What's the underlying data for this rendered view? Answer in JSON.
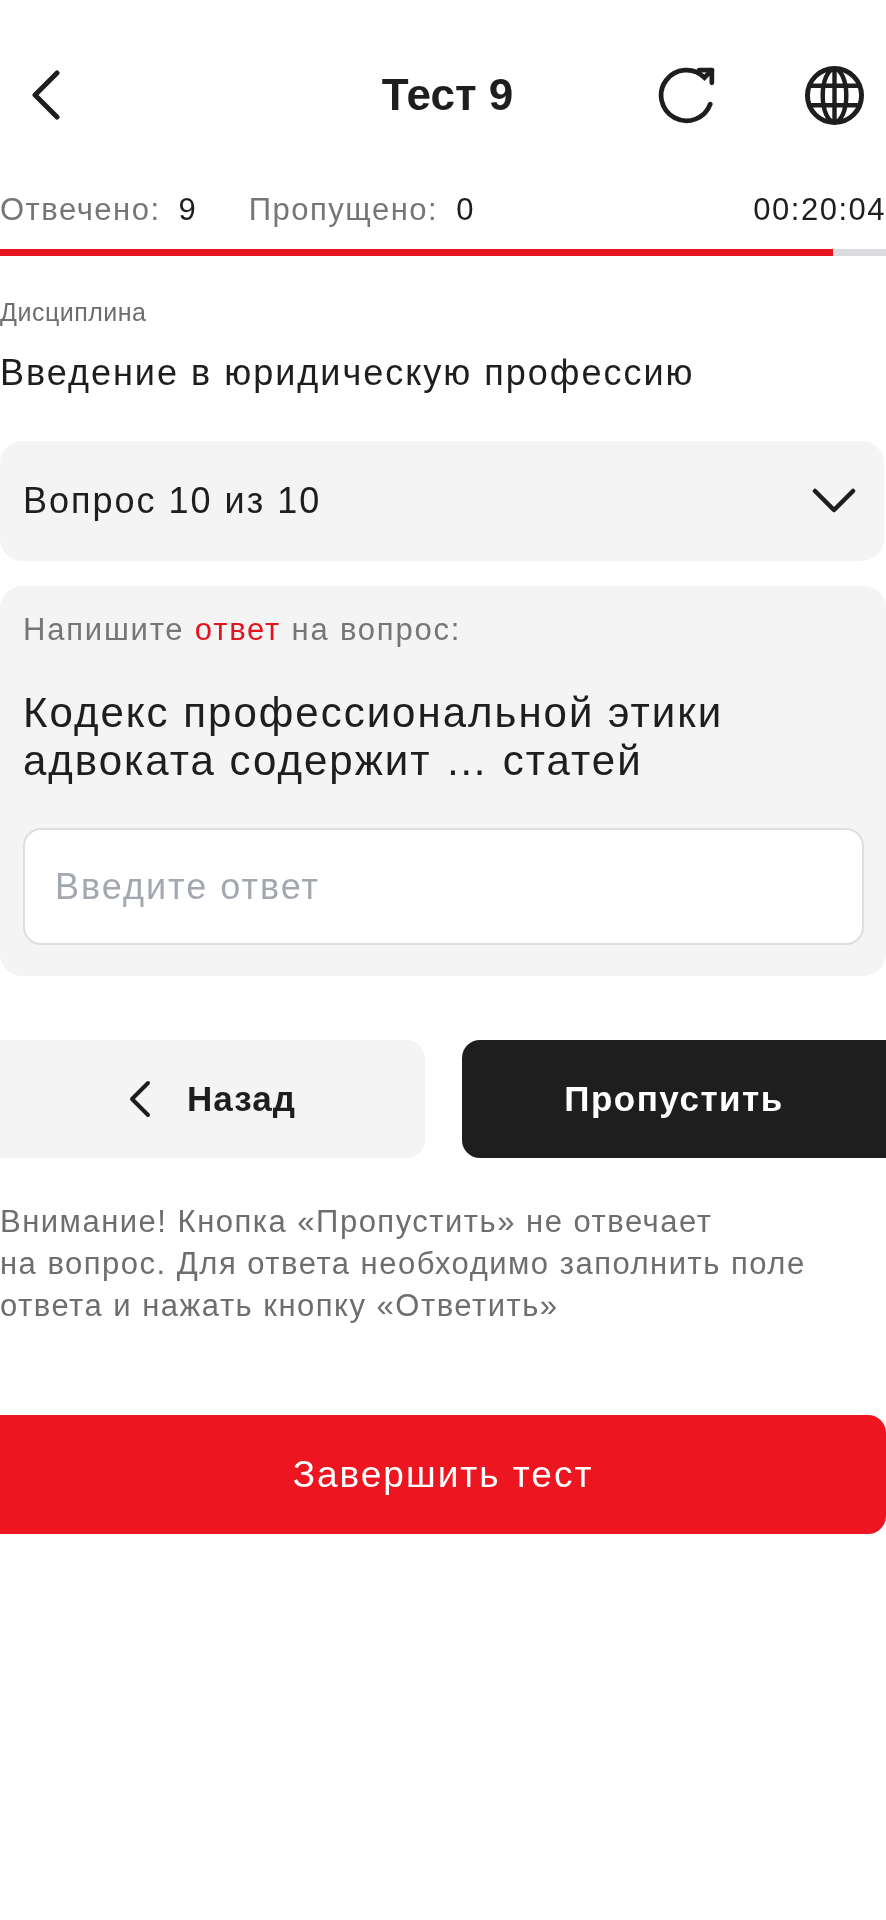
{
  "header": {
    "title": "Тест 9"
  },
  "stats": [
    {
      "label": "Отвечено:",
      "value": "9"
    },
    {
      "label": "Пропущено:",
      "value": "0"
    }
  ],
  "timer": "00:20:04",
  "progress": {
    "level": 0.94
  },
  "discipline": {
    "label": "Дисциплина",
    "value": "Введение в юридическую профессию"
  },
  "question_selector": {
    "label": "Вопрос 10 из 10",
    "expanded": false
  },
  "question_card": {
    "instruction": [
      {
        "text": "Напишите ",
        "highlight": false
      },
      {
        "text": "ответ",
        "highlight": true
      },
      {
        "text": " на вопрос:",
        "highlight": false
      }
    ],
    "question": "Кодекс профессиональной этики адвоката содержит … статей",
    "answer": {
      "placeholder": "Введите ответ"
    }
  },
  "nav_buttons": [
    {
      "kind": "back",
      "label": "Назад"
    },
    {
      "kind": "skip",
      "label": "Пропустить"
    }
  ],
  "notice": "Внимание! Кнопка «Пропустить» не отвечает на вопрос. Для ответа необходимо заполнить поле ответа и нажать кнопку «Ответить»",
  "finish_button": {
    "label": "Завершить тест"
  }
}
